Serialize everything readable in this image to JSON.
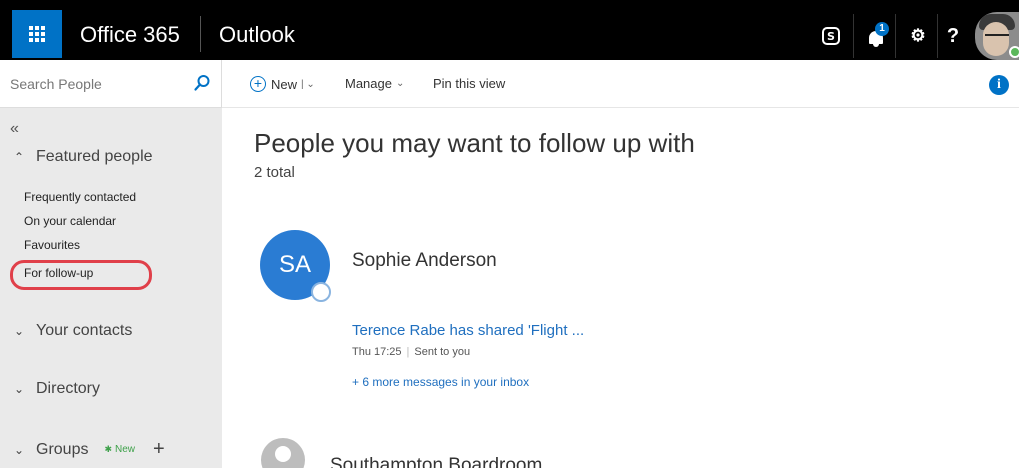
{
  "header": {
    "brand": "Office 365",
    "app": "Outlook",
    "skype_icon": "S",
    "notification_count": "1",
    "settings_icon": "⚙",
    "help_icon": "?"
  },
  "sidebar": {
    "search_placeholder": "Search People",
    "collapse_icon": "«",
    "featured": {
      "label": "Featured people",
      "items": [
        "Frequently contacted",
        "On your calendar",
        "Favourites",
        "For follow-up"
      ]
    },
    "your_contacts": "Your contacts",
    "directory": "Directory",
    "groups": "Groups",
    "groups_new_badge": "New"
  },
  "commandbar": {
    "new_label": "New",
    "manage_label": "Manage",
    "pin_label": "Pin this view"
  },
  "main": {
    "title": "People you may want to follow up with",
    "count": "2 total",
    "people": [
      {
        "initials": "SA",
        "name": "Sophie Anderson",
        "message_title": "Terence Rabe has shared 'Flight ...",
        "time": "Thu 17:25",
        "status": "Sent to you",
        "more": "+ 6 more messages in your inbox"
      },
      {
        "name": "Southampton Boardroom"
      }
    ]
  },
  "colors": {
    "brand_blue": "#0072c6",
    "topbar": "#000000",
    "sidebar_bg": "#eaeaea",
    "highlight": "#e0404a",
    "avatar_blue": "#2a7cd3",
    "link": "#1f6fbf",
    "new_green": "#3ea14a"
  }
}
